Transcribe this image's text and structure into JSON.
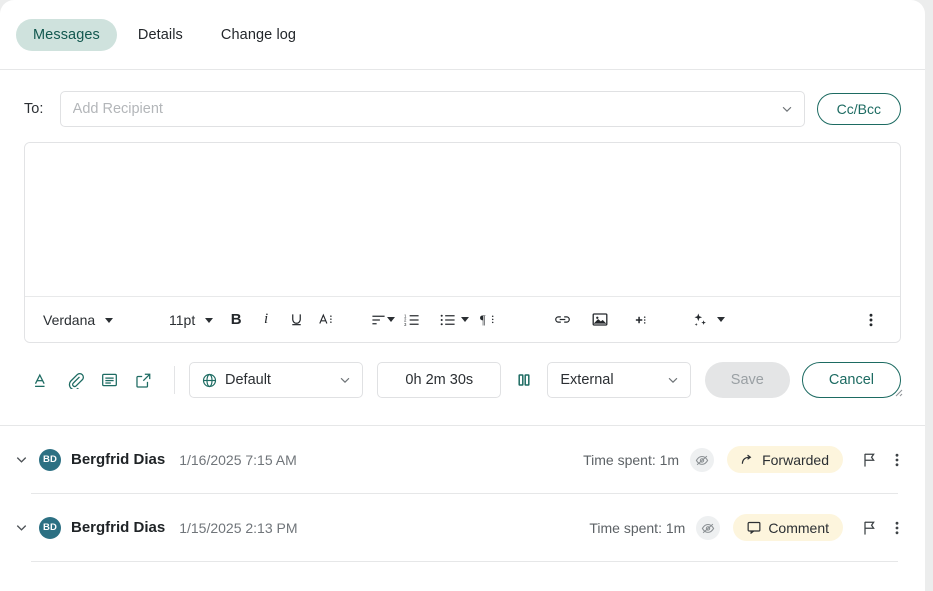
{
  "tabs": [
    {
      "label": "Messages",
      "active": true
    },
    {
      "label": "Details",
      "active": false
    },
    {
      "label": "Change log",
      "active": false
    }
  ],
  "compose": {
    "to_label": "To:",
    "recipient_placeholder": "Add Recipient",
    "recipient_value": "",
    "ccbcc_label": "Cc/Bcc",
    "body_value": "",
    "toolbar": {
      "font_family": "Verdana",
      "font_size": "11pt",
      "bold": "B",
      "italic": "i",
      "underline": "U",
      "text_color": "A",
      "align": "align-left",
      "numbered_list": "numbered-list",
      "bullet_list": "bullet-list",
      "paragraph": "¶",
      "link": "link",
      "image": "image",
      "insert": "+",
      "ai": "ai-sparkle",
      "more": "more-options"
    },
    "actions": {
      "signature": "signature",
      "attach": "attachment",
      "template": "template",
      "popout": "open-external",
      "channel_value": "Default",
      "timer_value": "0h 2m 30s",
      "pause": "pause",
      "visibility_value": "External",
      "save_label": "Save",
      "save_disabled": true,
      "cancel_label": "Cancel"
    }
  },
  "messages": [
    {
      "sender": "Bergfrid Dias",
      "initials": "BD",
      "timestamp": "1/16/2025 7:15 AM",
      "time_spent": "Time spent:  1m",
      "badge_label": "Forwarded",
      "badge_icon": "forward-arrow-icon"
    },
    {
      "sender": "Bergfrid Dias",
      "initials": "BD",
      "timestamp": "1/15/2025 2:13 PM",
      "time_spent": "Time spent:  1m",
      "badge_label": "Comment",
      "badge_icon": "comment-icon"
    }
  ],
  "colors": {
    "accent_teal": "#1d6b62",
    "tab_active_bg": "#cfe2dd",
    "tab_active_text": "#12584f",
    "avatar_bg": "#2c7083",
    "badge_bg": "#fdf5dd",
    "save_disabled_bg": "#e4e5e6"
  }
}
